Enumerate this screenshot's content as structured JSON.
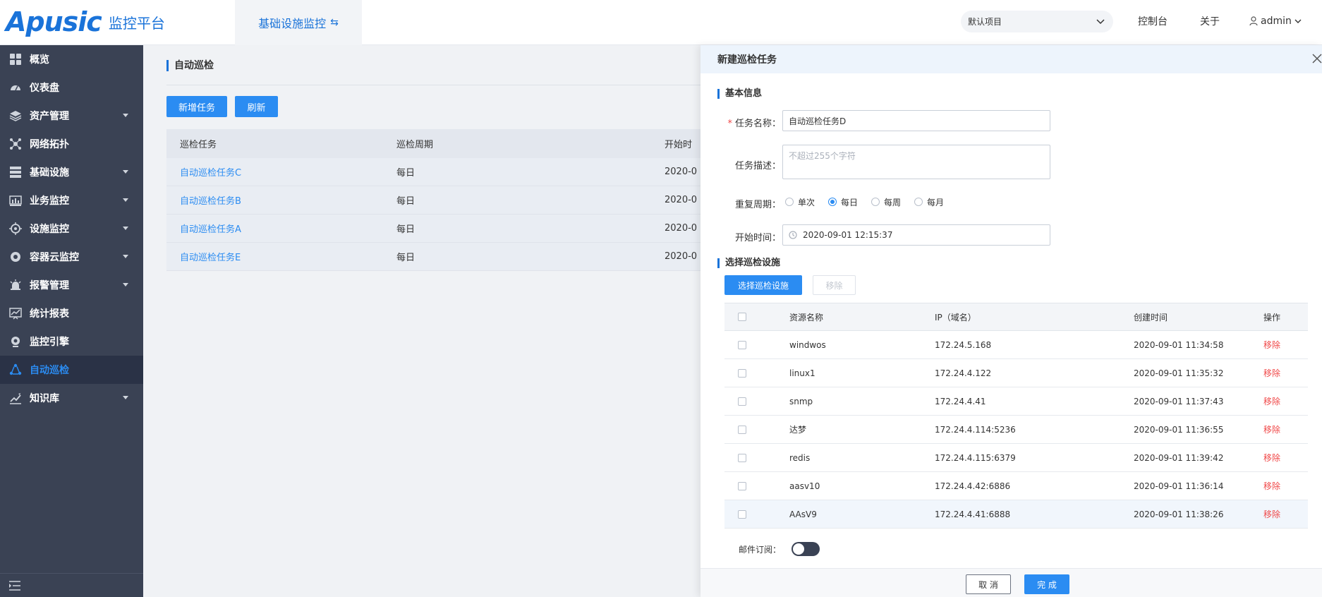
{
  "header": {
    "logo_mark": "Apusic",
    "logo_text": "监控平台",
    "active_tab": "基础设施监控",
    "project_select": "默认项目",
    "links": {
      "console": "控制台",
      "about": "关于",
      "user": "admin"
    }
  },
  "sidebar": {
    "items": [
      {
        "label": "概览",
        "icon": "grid-icon",
        "caret": false
      },
      {
        "label": "仪表盘",
        "icon": "dashboard-icon",
        "caret": false
      },
      {
        "label": "资产管理",
        "icon": "layers-icon",
        "caret": true
      },
      {
        "label": "网络拓扑",
        "icon": "topology-icon",
        "caret": false
      },
      {
        "label": "基础设施",
        "icon": "server-icon",
        "caret": true
      },
      {
        "label": "业务监控",
        "icon": "bar-chart-icon",
        "caret": true
      },
      {
        "label": "设施监控",
        "icon": "target-icon",
        "caret": true
      },
      {
        "label": "容器云监控",
        "icon": "gear-icon",
        "caret": true
      },
      {
        "label": "报警管理",
        "icon": "alarm-icon",
        "caret": true
      },
      {
        "label": "统计报表",
        "icon": "report-icon",
        "caret": false
      },
      {
        "label": "监控引擎",
        "icon": "camera-icon",
        "caret": false
      },
      {
        "label": "自动巡检",
        "icon": "cycle-icon",
        "caret": false,
        "active": true
      },
      {
        "label": "知识库",
        "icon": "pen-chart-icon",
        "caret": true
      }
    ]
  },
  "main": {
    "title": "自动巡检",
    "buttons": {
      "add": "新增任务",
      "refresh": "刷新"
    },
    "table": {
      "columns": [
        "巡检任务",
        "巡检周期",
        "开始时"
      ],
      "rows": [
        {
          "task": "自动巡检任务C",
          "cycle": "每日",
          "start": "2020-0"
        },
        {
          "task": "自动巡检任务B",
          "cycle": "每日",
          "start": "2020-0"
        },
        {
          "task": "自动巡检任务A",
          "cycle": "每日",
          "start": "2020-0"
        },
        {
          "task": "自动巡检任务E",
          "cycle": "每日",
          "start": "2020-0"
        }
      ]
    }
  },
  "drawer": {
    "title": "新建巡检任务",
    "basic_section": "基本信息",
    "name_label": "任务名称：",
    "name_value": "自动巡检任务D",
    "desc_label": "任务描述：",
    "desc_placeholder": "不超过255个字符",
    "cycle_label": "重复周期：",
    "cycle_options": [
      "单次",
      "每日",
      "每周",
      "每月"
    ],
    "cycle_selected": "每日",
    "start_label": "开始时间：",
    "start_value": "2020-09-01 12:15:37",
    "device_section": "选择巡检设施",
    "select_button": "选择巡检设施",
    "remove_button": "移除",
    "device_table": {
      "columns": [
        "资源名称",
        "IP（域名）",
        "创建时间",
        "操作"
      ],
      "rows": [
        {
          "name": "windwos",
          "ip": "172.24.5.168",
          "created": "2020-09-01 11:34:58",
          "action": "移除"
        },
        {
          "name": "linux1",
          "ip": "172.24.4.122",
          "created": "2020-09-01 11:35:32",
          "action": "移除"
        },
        {
          "name": "snmp",
          "ip": "172.24.4.41",
          "created": "2020-09-01 11:37:43",
          "action": "移除"
        },
        {
          "name": "达梦",
          "ip": "172.24.4.114:5236",
          "created": "2020-09-01 11:36:55",
          "action": "移除"
        },
        {
          "name": "redis",
          "ip": "172.24.4.115:6379",
          "created": "2020-09-01 11:39:42",
          "action": "移除"
        },
        {
          "name": "aasv10",
          "ip": "172.24.4.42:6886",
          "created": "2020-09-01 11:36:14",
          "action": "移除"
        },
        {
          "name": "AAsV9",
          "ip": "172.24.4.41:6888",
          "created": "2020-09-01 11:38:26",
          "action": "移除"
        }
      ]
    },
    "email_label": "邮件订阅：",
    "email_enabled": false,
    "cancel": "取 消",
    "ok": "完 成"
  },
  "colors": {
    "primary": "#2b8cf2",
    "sidebar": "#3a4254",
    "danger": "#f04848"
  }
}
